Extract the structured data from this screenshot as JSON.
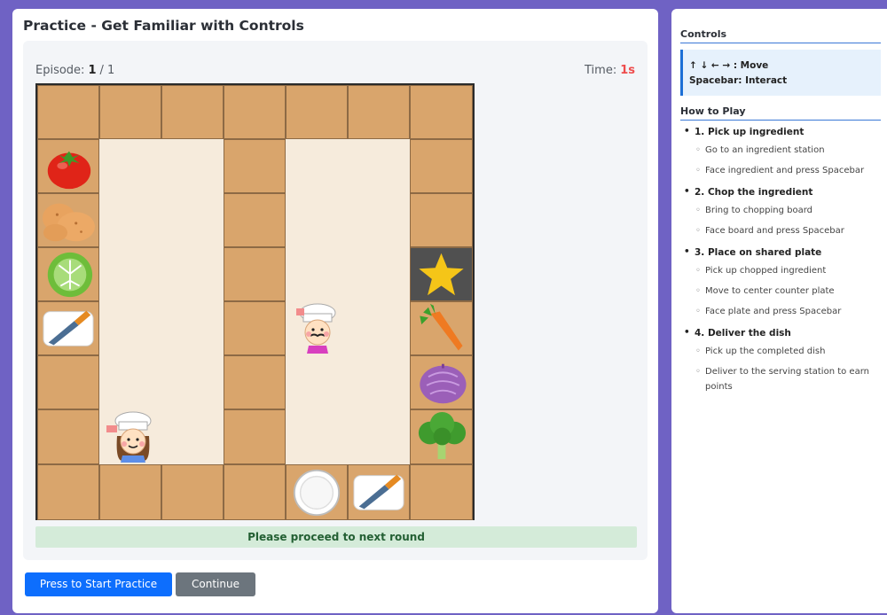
{
  "page": {
    "title": "Practice - Get Familiar with Controls"
  },
  "game": {
    "episode_label": "Episode:",
    "episode_current": "1",
    "episode_total": "/ 1",
    "time_label": "Time:",
    "time_value": "1s",
    "status_message": "Please proceed to next round"
  },
  "buttons": {
    "start": "Press to Start Practice",
    "continue": "Continue"
  },
  "sidebar": {
    "controls_heading": "Controls",
    "controls_move": "↑ ↓ ← → : Move",
    "controls_interact": "Spacebar: Interact",
    "howto_heading": "How to Play",
    "steps": [
      {
        "title": "1. Pick up ingredient",
        "subs": [
          "Go to an ingredient station",
          "Face ingredient and press Spacebar"
        ]
      },
      {
        "title": "2. Chop the ingredient",
        "subs": [
          "Bring to chopping board",
          "Face board and press Spacebar"
        ]
      },
      {
        "title": "3. Place on shared plate",
        "subs": [
          "Pick up chopped ingredient",
          "Move to center counter plate",
          "Face plate and press Spacebar"
        ]
      },
      {
        "title": "4. Deliver the dish",
        "subs": [
          "Pick up the completed dish",
          "Deliver to the serving station to earn points"
        ]
      }
    ]
  },
  "colors": {
    "background": "#6f62c4",
    "primary_button": "#0d6efd",
    "secondary_button": "#6c757d",
    "status_bg": "#d4ebd9",
    "timer": "#ee4c4c",
    "accent": "#1c6fd6"
  },
  "icons": [
    "tomato-icon",
    "potato-icon",
    "cabbage-icon",
    "knife-icon",
    "star-icon",
    "carrot-icon",
    "onion-icon",
    "broccoli-icon",
    "plate-icon",
    "chef-icon"
  ]
}
